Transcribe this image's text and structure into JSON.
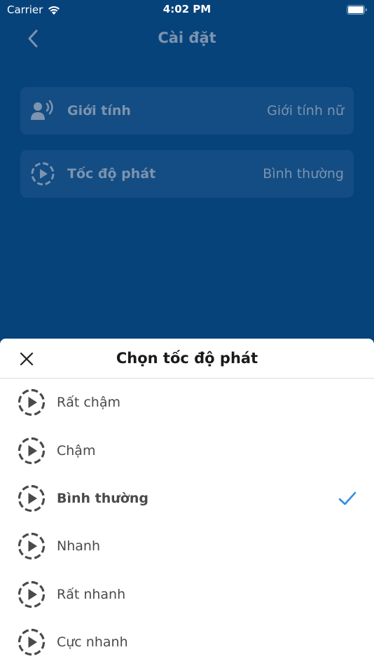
{
  "status": {
    "carrier": "Carrier",
    "time": "4:02 PM"
  },
  "header": {
    "title": "Cài đặt",
    "back_icon": "chevron-left-icon"
  },
  "settings": [
    {
      "icon": "voice-icon",
      "label": "Giới tính",
      "value": "Giới tính nữ"
    },
    {
      "icon": "play-circle-icon",
      "label": "Tốc độ phát",
      "value": "Bình thường"
    }
  ],
  "sheet": {
    "title": "Chọn tốc độ phát",
    "close_icon": "close-icon",
    "options": [
      {
        "label": "Rất chậm",
        "selected": false
      },
      {
        "label": "Chậm",
        "selected": false
      },
      {
        "label": "Bình thường",
        "selected": true
      },
      {
        "label": "Nhanh",
        "selected": false
      },
      {
        "label": "Rất nhanh",
        "selected": false
      },
      {
        "label": "Cực nhanh",
        "selected": false
      }
    ]
  },
  "colors": {
    "background": "#07437b",
    "row_background": "#134d83",
    "muted_text": "#7d93ae",
    "check_accent": "#2f8fe0"
  }
}
